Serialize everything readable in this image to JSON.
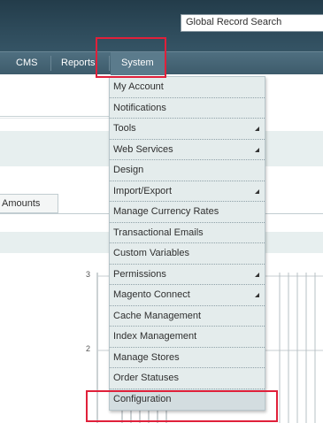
{
  "header": {
    "search_placeholder": "Global Record Search"
  },
  "nav": {
    "items": [
      "CMS",
      "Reports",
      "System"
    ],
    "active": "System"
  },
  "content": {
    "tab_label": "Amounts",
    "chart_ticks": [
      "3",
      "2"
    ]
  },
  "system_menu": {
    "items": [
      {
        "label": "My Account",
        "submenu": false
      },
      {
        "label": "Notifications",
        "submenu": false
      },
      {
        "label": "Tools",
        "submenu": true
      },
      {
        "label": "Web Services",
        "submenu": true
      },
      {
        "label": "Design",
        "submenu": false
      },
      {
        "label": "Import/Export",
        "submenu": true
      },
      {
        "label": "Manage Currency Rates",
        "submenu": false
      },
      {
        "label": "Transactional Emails",
        "submenu": false
      },
      {
        "label": "Custom Variables",
        "submenu": false
      },
      {
        "label": "Permissions",
        "submenu": true
      },
      {
        "label": "Magento Connect",
        "submenu": true
      },
      {
        "label": "Cache Management",
        "submenu": false
      },
      {
        "label": "Index Management",
        "submenu": false
      },
      {
        "label": "Manage Stores",
        "submenu": false
      },
      {
        "label": "Order Statuses",
        "submenu": false
      },
      {
        "label": "Configuration",
        "submenu": false
      }
    ],
    "submenu_icon": "submenu-arrow-icon"
  },
  "colors": {
    "header_dark": "#2e4b5b",
    "nav_bar": "#4f6f80",
    "menu_bg": "#e4ecec",
    "highlight": "#e0203a"
  }
}
